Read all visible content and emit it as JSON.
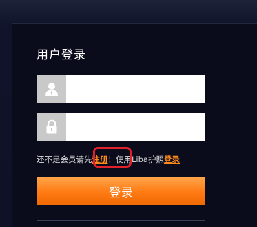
{
  "login": {
    "title": "用户登录",
    "username": {
      "value": "",
      "placeholder": ""
    },
    "password": {
      "value": "",
      "placeholder": ""
    },
    "hint": {
      "prefix": "还不是会员请先",
      "register_link": "注册",
      "exclaim": "！",
      "middle": "使用Liba护照",
      "login_link": "登录"
    },
    "submit_label": "登录"
  },
  "icons": {
    "username": "user-icon",
    "password": "lock-icon"
  },
  "colors": {
    "background": "#0a0c1c",
    "accent": "#ff7a12",
    "link": "#ff8a1a",
    "highlight": "#e0202a"
  }
}
